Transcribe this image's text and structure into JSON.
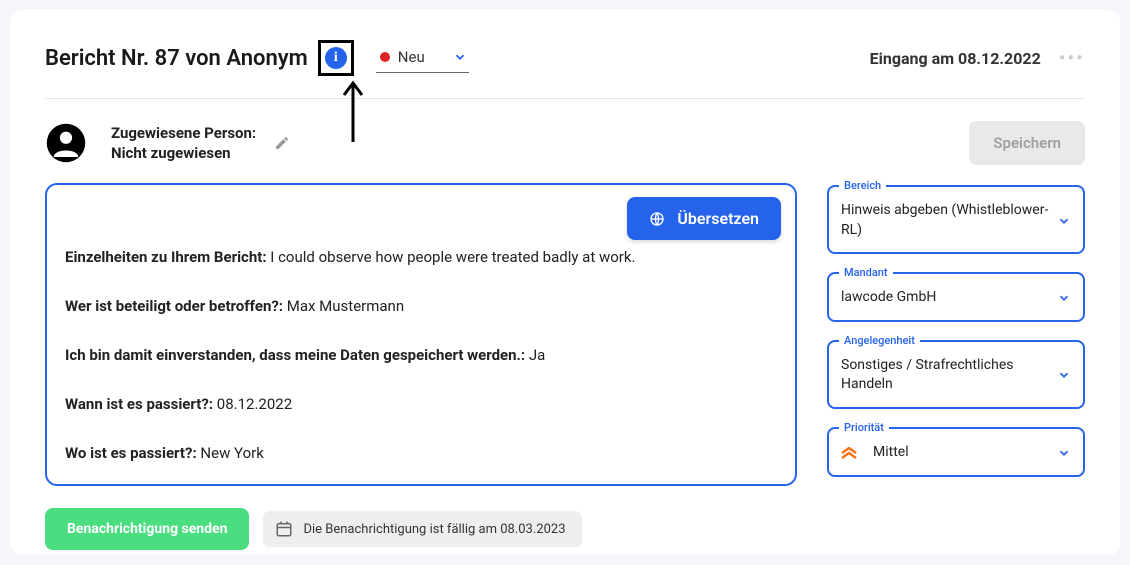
{
  "header": {
    "title": "Bericht Nr. 87 von Anonym",
    "status_label": "Neu",
    "received_label": "Eingang am 08.12.2022"
  },
  "assignee": {
    "label_line1": "Zugewiesene Person:",
    "label_line2": "Nicht zugewiesen"
  },
  "save_label": "Speichern",
  "translate_label": "Übersetzen",
  "details": {
    "f1_label": "Einzelheiten zu Ihrem Bericht:",
    "f1_value": " I could observe how people were treated badly at work.",
    "f2_label": "Wer ist beteiligt oder betroffen?:",
    "f2_value": " Max Mustermann",
    "f3_label": "Ich bin damit einverstanden, dass meine Daten gespeichert werden.:",
    "f3_value": " Ja",
    "f4_label": "Wann ist es passiert?:",
    "f4_value": " 08.12.2022",
    "f5_label": "Wo ist es passiert?:",
    "f5_value": " New York"
  },
  "side": {
    "bereich_legend": "Bereich",
    "bereich_value": "Hinweis abgeben (Whistleblower-RL)",
    "mandant_legend": "Mandant",
    "mandant_value": "lawcode GmbH",
    "angelegenheit_legend": "Angelegenheit",
    "angelegenheit_value": "Sonstiges / Strafrechtliches Handeln",
    "prioritaet_legend": "Priorität",
    "prioritaet_value": "Mittel"
  },
  "footer": {
    "notify_label": "Benachrichtigung senden",
    "due_text": "Die Benachrichtigung ist fällig am 08.03.2023"
  }
}
